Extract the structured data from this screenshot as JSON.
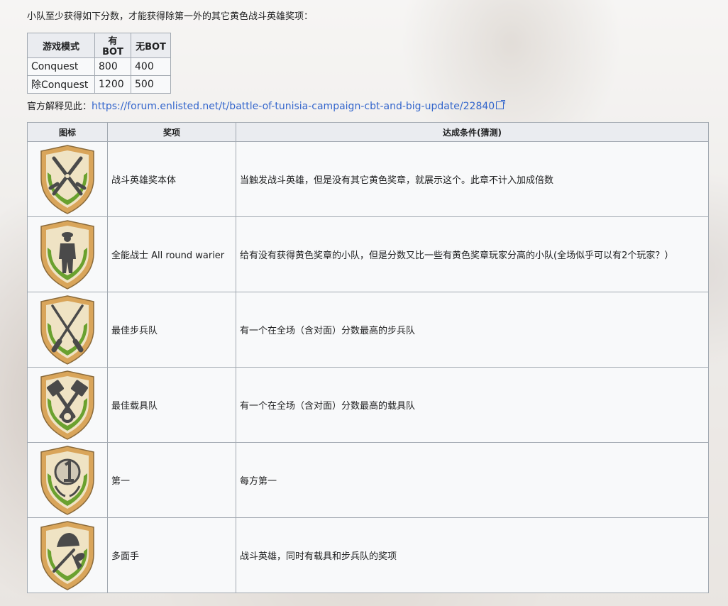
{
  "intro": "小队至少获得如下分数，才能获得除第一外的其它黄色战斗英雄奖项：",
  "score_table": {
    "headers": [
      "游戏模式",
      "有BOT",
      "无BOT"
    ],
    "rows": [
      [
        "Conquest",
        "800",
        "400"
      ],
      [
        "除Conquest",
        "1200",
        "500"
      ]
    ]
  },
  "official": {
    "label": "官方解释见此：",
    "link_text": "https://forum.enlisted.net/t/battle-of-tunisia-campaign-cbt-and-big-update/22840"
  },
  "awards_table": {
    "headers": [
      "图标",
      "奖项",
      "达成条件(猜测)"
    ],
    "rows": [
      {
        "icon": "crossed-swords-badge-icon",
        "name": "战斗英雄奖本体",
        "condition": "当触发战斗英雄，但是没有其它黄色奖章，就展示这个。此章不计入加成倍数"
      },
      {
        "icon": "soldier-badge-icon",
        "name": "全能战士 All round warier",
        "condition": "给有没有获得黄色奖章的小队，但是分数又比一些有黄色奖章玩家分高的小队(全场似乎可以有2个玩家？）"
      },
      {
        "icon": "crossed-rifles-badge-icon",
        "name": "最佳步兵队",
        "condition": "有一个在全场（含对面）分数最高的步兵队"
      },
      {
        "icon": "crossed-pistons-badge-icon",
        "name": "最佳载具队",
        "condition": "有一个在全场（含对面）分数最高的载具队"
      },
      {
        "icon": "number-one-badge-icon",
        "name": "第一",
        "condition": "每方第一"
      },
      {
        "icon": "helmet-knife-badge-icon",
        "name": "多面手",
        "condition": "战斗英雄，同时有载具和步兵队的奖项"
      }
    ]
  },
  "colors": {
    "link": "#3366cc",
    "badge_gold": "#d9a55a",
    "badge_green": "#6aa12f",
    "badge_cream": "#efe3c4",
    "badge_dark": "#4a4a4a"
  }
}
